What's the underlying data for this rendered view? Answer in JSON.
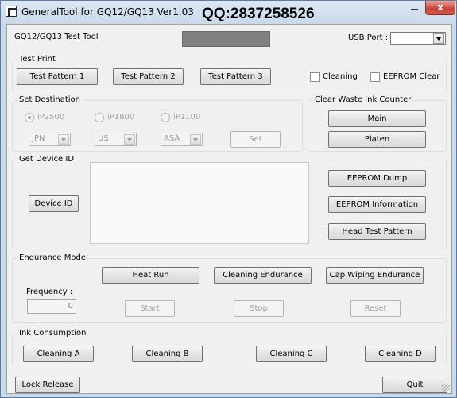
{
  "window": {
    "title": "GeneralTool for GQ12/GQ13 Ver1.03",
    "watermark": "QQ:2837258526",
    "close_glyph": "x"
  },
  "header": {
    "app_label": "GQ12/GQ13 Test Tool",
    "usb_port_label": "USB Port :",
    "usb_port_value": ""
  },
  "test_print": {
    "title": "Test Print",
    "buttons": [
      "Test Pattern 1",
      "Test Pattern 2",
      "Test Pattern 3"
    ],
    "cleaning_label": "Cleaning",
    "eeprom_clear_label": "EEPROM Clear"
  },
  "set_destination": {
    "title": "Set Destination",
    "radios": [
      {
        "label": "iP2500",
        "checked": true
      },
      {
        "label": "iP1800",
        "checked": false
      },
      {
        "label": "iP1100",
        "checked": false
      }
    ],
    "combos": [
      "JPN",
      "US",
      "ASA"
    ],
    "set_label": "Set"
  },
  "clear_waste": {
    "title": "Clear Waste Ink Counter",
    "main_label": "Main",
    "platen_label": "Platen"
  },
  "device_id": {
    "title": "Get Device ID",
    "button_label": "Device ID",
    "eeprom_dump": "EEPROM Dump",
    "eeprom_information": "EEPROM Information",
    "head_test_pattern": "Head Test Pattern"
  },
  "endurance": {
    "title": "Endurance Mode",
    "heat_run": "Heat Run",
    "cleaning_endurance": "Cleaning Endurance",
    "cap_wiping_endurance": "Cap Wiping Endurance",
    "frequency_label": "Frequency :",
    "frequency_value": "0",
    "start": "Start",
    "stop": "Stop",
    "reset": "Reset"
  },
  "ink_consumption": {
    "title": "Ink Consumption",
    "buttons": [
      "Cleaning A",
      "Cleaning B",
      "Cleaning C",
      "Cleaning D"
    ]
  },
  "footer": {
    "lock_release": "Lock Release",
    "quit": "Quit"
  },
  "colors": {
    "title_bar": "#d7e4f2",
    "dialog_bg": "#f0f0f0",
    "close_button": "#c7443a",
    "gray_box": "#808080"
  }
}
